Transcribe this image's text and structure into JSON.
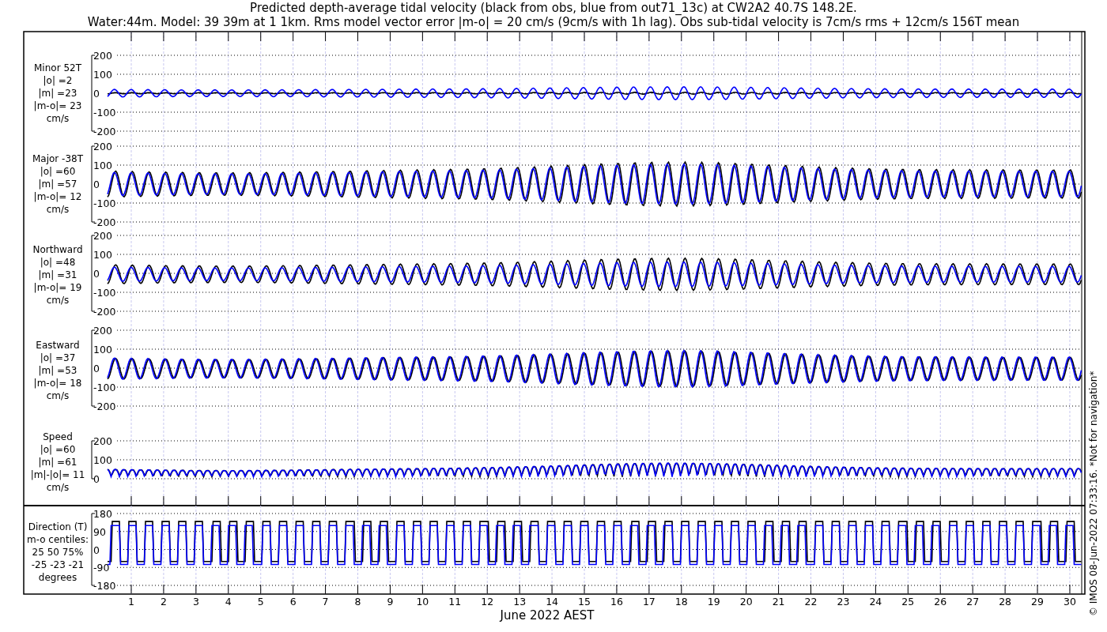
{
  "title_lines": [
    "Predicted depth-average tidal velocity (black from obs, blue from out71_13c) at CW2A2 40.7S 148.2E.",
    "Water:44m. Model: 39 39m at 1 1km. Rms model vector error |m-o| = 20 cm/s (9cm/s with 1h lag). Obs sub-tidal velocity is 7cm/s rms + 12cm/s 156T mean"
  ],
  "panels": [
    {
      "kind": "signed",
      "label_lines": [
        "Minor 52T",
        "|o| =2",
        "|m| =23",
        "|m-o|= 23",
        "cm/s"
      ],
      "yticks": [
        "200",
        "100",
        "0",
        "-100",
        "-200"
      ]
    },
    {
      "kind": "signed",
      "label_lines": [
        "Major -38T",
        "|o| =60",
        "|m| =57",
        "|m-o|= 12",
        "cm/s"
      ],
      "yticks": [
        "200",
        "100",
        "0",
        "-100",
        "-200"
      ]
    },
    {
      "kind": "signed",
      "label_lines": [
        "Northward",
        "|o| =48",
        "|m| =31",
        "|m-o|= 19",
        "cm/s"
      ],
      "yticks": [
        "200",
        "100",
        "0",
        "-100",
        "-200"
      ]
    },
    {
      "kind": "signed",
      "label_lines": [
        "Eastward",
        "|o| =37",
        "|m| =53",
        "|m-o|= 18",
        "cm/s"
      ],
      "yticks": [
        "200",
        "100",
        "0",
        "-100",
        "-200"
      ]
    },
    {
      "kind": "speed",
      "label_lines": [
        "Speed",
        "|o| =60",
        "|m| =61",
        "|m|-|o|= 11",
        "cm/s"
      ],
      "yticks": [
        "200",
        "100",
        "0"
      ]
    },
    {
      "kind": "direction",
      "label_lines": [
        "Direction (T)",
        "m-o centiles:",
        "25  50  75%",
        "-25 -23 -21",
        "degrees"
      ],
      "yticks": [
        "180",
        "90",
        "0",
        "-90",
        "-180"
      ]
    }
  ],
  "x_axis": {
    "day_labels": [
      "1",
      "2",
      "3",
      "4",
      "5",
      "6",
      "7",
      "8",
      "9",
      "10",
      "11",
      "12",
      "13",
      "14",
      "15",
      "16",
      "17",
      "18",
      "19",
      "20",
      "21",
      "22",
      "23",
      "24",
      "25",
      "26",
      "27",
      "28",
      "29",
      "30"
    ],
    "label": "June 2022 AEST"
  },
  "footer_note": "© IMOS 08-Jun-2022 07:33:16. *Not for navigation*"
}
